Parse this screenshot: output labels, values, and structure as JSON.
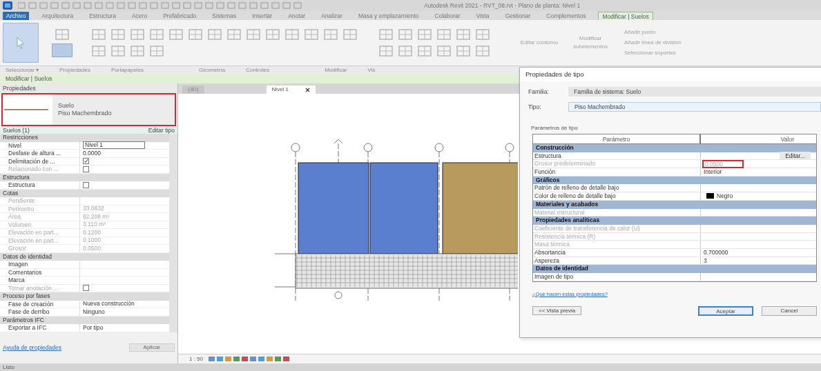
{
  "title": "Autodesk Revit 2021 - RVT_08.rvt - Plano de planta: Nivel 1",
  "ribbon_tabs": [
    {
      "label": "Archivo",
      "kind": "file",
      "selected": false
    },
    {
      "label": "Arquitectura",
      "kind": "normal",
      "selected": false
    },
    {
      "label": "Estructura",
      "kind": "normal",
      "selected": false
    },
    {
      "label": "Acero",
      "kind": "normal",
      "selected": false
    },
    {
      "label": "Prefabricado",
      "kind": "normal",
      "selected": false
    },
    {
      "label": "Sistemas",
      "kind": "normal",
      "selected": false
    },
    {
      "label": "Insertar",
      "kind": "normal",
      "selected": false
    },
    {
      "label": "Anotar",
      "kind": "normal",
      "selected": false
    },
    {
      "label": "Analizar",
      "kind": "normal",
      "selected": false
    },
    {
      "label": "Masa y emplazamiento",
      "kind": "normal",
      "selected": false
    },
    {
      "label": "Colaborar",
      "kind": "normal",
      "selected": false
    },
    {
      "label": "Vista",
      "kind": "normal",
      "selected": false
    },
    {
      "label": "Gestionar",
      "kind": "normal",
      "selected": false
    },
    {
      "label": "Complementos",
      "kind": "normal",
      "selected": false
    },
    {
      "label": "Modificar | Suelos",
      "kind": "contextual",
      "selected": true
    }
  ],
  "panel_labels": [
    "Seleccionar ▾",
    "Propiedades",
    "Portapapeles",
    "Geometría",
    "Controles",
    "Modificar",
    "Vis"
  ],
  "ribbon_right_items": [
    "Añadir punto",
    "Añadir línea de división",
    "Seleccionar soportes"
  ],
  "ribbon_mid_items": [
    "Editar contorno",
    "Modificar subelementos"
  ],
  "context_bar": "Modificar | Suelos",
  "properties": {
    "title": "Propiedades",
    "type_family": "Suelo",
    "type_name": "Piso Machembrado",
    "instance_label": "Suelos (1)",
    "edit_type": "Editar tipo",
    "rows": [
      {
        "kind": "header",
        "label": "Restricciones"
      },
      {
        "kind": "select",
        "label": "Nivel",
        "value": "Nivel 1",
        "disabled": false
      },
      {
        "kind": "text",
        "label": "Desfase de altura ...",
        "value": "0.0000",
        "disabled": false
      },
      {
        "kind": "check",
        "label": "Delimitación de ...",
        "checked": true,
        "disabled": false
      },
      {
        "kind": "check",
        "label": "Relacionado con ...",
        "checked": false,
        "disabled": true
      },
      {
        "kind": "header",
        "label": "Estructura"
      },
      {
        "kind": "check",
        "label": "Estructura",
        "checked": false,
        "disabled": false
      },
      {
        "kind": "header",
        "label": "Cotas"
      },
      {
        "kind": "text",
        "label": "Pendiente",
        "disabled": true
      },
      {
        "kind": "text",
        "label": "Perímetro",
        "value": "33.0832",
        "disabled": true
      },
      {
        "kind": "text",
        "label": "Área",
        "value": "62.208 m²",
        "disabled": true
      },
      {
        "kind": "text",
        "label": "Volumen",
        "value": "3.110 m³",
        "disabled": true
      },
      {
        "kind": "text",
        "label": "Elevación en part...",
        "value": "0.1200",
        "disabled": true
      },
      {
        "kind": "text",
        "label": "Elevación en part...",
        "value": "0.1000",
        "disabled": true
      },
      {
        "kind": "text",
        "label": "Grosor",
        "value": "0.0500",
        "disabled": true
      },
      {
        "kind": "header",
        "label": "Datos de identidad"
      },
      {
        "kind": "text",
        "label": "Imagen",
        "disabled": false
      },
      {
        "kind": "text",
        "label": "Comentarios",
        "disabled": false
      },
      {
        "kind": "text",
        "label": "Marca",
        "disabled": false
      },
      {
        "kind": "check",
        "label": "Tomar anotación ...",
        "checked": false,
        "disabled": true
      },
      {
        "kind": "header",
        "label": "Proceso por fases"
      },
      {
        "kind": "text",
        "label": "Fase de creación",
        "value": "Nueva construcción",
        "disabled": false
      },
      {
        "kind": "text",
        "label": "Fase de derribo",
        "value": "Ninguno",
        "disabled": false
      },
      {
        "kind": "header",
        "label": "Parámetros IFC"
      },
      {
        "kind": "text",
        "label": "Exportar a IFC",
        "value": "Por tipo",
        "disabled": false
      }
    ],
    "help_link": "Ayuda de propiedades",
    "apply_button": "Aplicar"
  },
  "view_tabs": [
    {
      "label": "{3D}",
      "selected": false
    },
    {
      "label": "Nivel 1",
      "selected": true
    }
  ],
  "view_scale": "1 : 50",
  "dialog": {
    "title": "Propiedades de tipo",
    "family_label": "Familia:",
    "family_value": "Familia de sistema: Suelo",
    "type_label": "Tipo:",
    "type_value": "Piso Machembrado",
    "params_label": "Parámetros de tipo",
    "columns": [
      "Parámetro",
      "Valor"
    ],
    "rows": [
      {
        "kind": "header",
        "label": "Construcción"
      },
      {
        "kind": "button",
        "label": "Estructura",
        "value": "Editar...",
        "disabled": false
      },
      {
        "kind": "text",
        "label": "Grosor predeterminado",
        "value": "0.0500",
        "disabled": true,
        "highlighted": true
      },
      {
        "kind": "text",
        "label": "Función",
        "value": "Interior",
        "disabled": false
      },
      {
        "kind": "header",
        "label": "Gráficos"
      },
      {
        "kind": "text",
        "label": "Patrón de relleno de detalle bajo",
        "disabled": false
      },
      {
        "kind": "color",
        "label": "Color de relleno de detalle bajo",
        "value": "Negro",
        "color": "#000000",
        "disabled": false
      },
      {
        "kind": "header",
        "label": "Materiales y acabados"
      },
      {
        "kind": "text",
        "label": "Material estructural",
        "disabled": true
      },
      {
        "kind": "header",
        "label": "Propiedades analíticas"
      },
      {
        "kind": "text",
        "label": "Coeficiente de transferencia de calor (U)",
        "disabled": true
      },
      {
        "kind": "text",
        "label": "Resistencia térmica (R)",
        "disabled": true
      },
      {
        "kind": "text",
        "label": "Masa térmica",
        "disabled": true
      },
      {
        "kind": "text",
        "label": "Absortancia",
        "value": "0.700000",
        "disabled": false
      },
      {
        "kind": "text",
        "label": "Aspereza",
        "value": "3",
        "disabled": false
      },
      {
        "kind": "header",
        "label": "Datos de identidad"
      },
      {
        "kind": "text",
        "label": "Imagen de tipo",
        "disabled": false
      }
    ],
    "link": "¿Qué hacen estas propiedades?",
    "preview_button": "<< Vista previa",
    "buttons": [
      "Aceptar",
      "Cancel"
    ]
  },
  "status": "Listo"
}
